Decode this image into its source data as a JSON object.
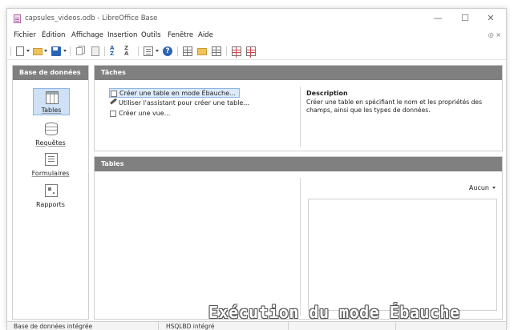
{
  "window": {
    "title": "capsules_videos.odb - LibreOffice Base",
    "controls": {
      "minimize": "—",
      "maximize": "☐",
      "close": "✕"
    }
  },
  "menubar": {
    "items": [
      {
        "label": "Fichier"
      },
      {
        "label": "Édition"
      },
      {
        "label": "Affichage"
      },
      {
        "label": "Insertion"
      },
      {
        "label": "Outils"
      },
      {
        "label": "Fenêtre"
      },
      {
        "label": "Aide"
      }
    ],
    "right_icons": "◎ ×"
  },
  "sidebar": {
    "header": "Base de données",
    "items": [
      {
        "label": "Tables",
        "icon": "table-icon",
        "selected": true
      },
      {
        "label": "Requêtes",
        "icon": "query-icon",
        "selected": false
      },
      {
        "label": "Formulaires",
        "icon": "form-icon",
        "selected": false
      },
      {
        "label": "Rapports",
        "icon": "report-icon",
        "selected": false
      }
    ]
  },
  "tasks": {
    "header": "Tâches",
    "items": [
      {
        "label": "Créer une table en mode Ébauche...",
        "highlighted": true
      },
      {
        "label": "Utiliser l'assistant pour créer une table...",
        "highlighted": false
      },
      {
        "label": "Créer une vue...",
        "highlighted": false
      }
    ],
    "description_title": "Description",
    "description_text": "Créer une table en spécifiant le nom et les propriétés des champs, ainsi que les types de données."
  },
  "tables": {
    "header": "Tables",
    "preview_selector": "Aucun"
  },
  "statusbar": {
    "left": "Base de données intégrée",
    "middle": "HSQLBD intégré"
  },
  "caption": "Exécution du mode Ébauche",
  "colors": {
    "panel_header": "#808080",
    "selection": "#cfe1f7",
    "selection_border": "#8fb5e6"
  }
}
